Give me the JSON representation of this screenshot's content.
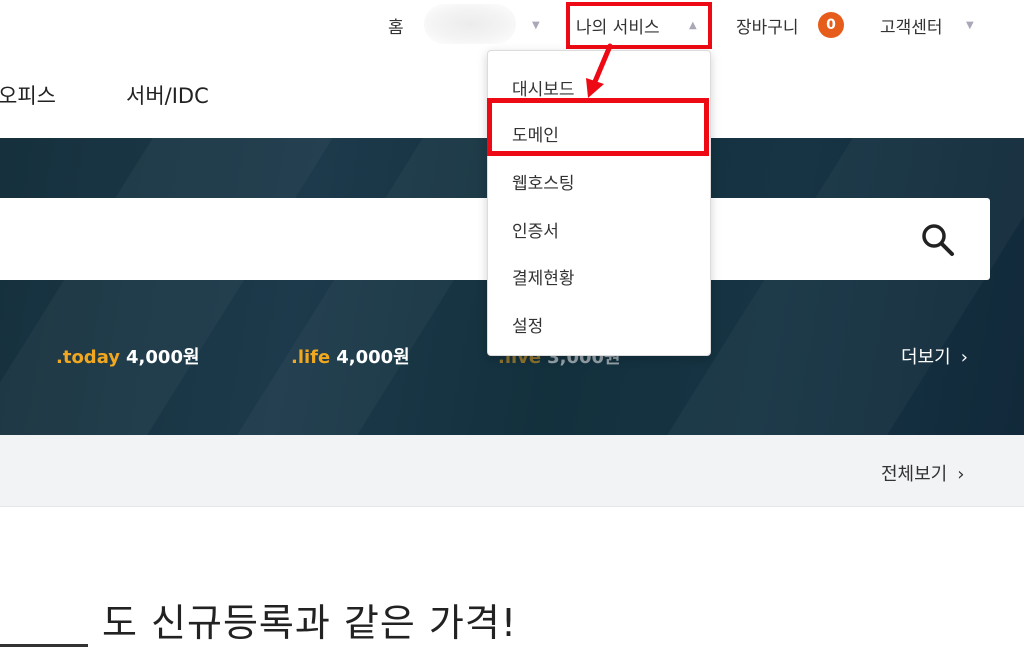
{
  "topbar": {
    "home_label": "홈",
    "my_service_label": "나의 서비스",
    "cart_label": "장바구니",
    "cart_count": "0",
    "customer_center_label": "고객센터"
  },
  "main_nav": {
    "items": [
      {
        "label": "오피스"
      },
      {
        "label": "서버/IDC"
      }
    ]
  },
  "hero": {
    "prices": [
      {
        "tld": ".today",
        "price": "4,000원"
      },
      {
        "tld": ".life",
        "price": "4,000원"
      },
      {
        "tld": ".live",
        "price": "3,000원"
      }
    ],
    "more_label": "더보기"
  },
  "strip": {
    "view_all_label": "전체보기"
  },
  "headline": {
    "text": "도 신규등록과 같은 가격!"
  },
  "dropdown": {
    "items": [
      {
        "label": "대시보드"
      },
      {
        "label": "도메인"
      },
      {
        "label": "웹호스팅"
      },
      {
        "label": "인증서"
      },
      {
        "label": "결제현황"
      },
      {
        "label": "설정"
      }
    ]
  },
  "colors": {
    "highlight": "#ee0a14",
    "tld_accent": "#f2a81e",
    "badge": "#e65c1a",
    "hero_bg": "#16303d"
  },
  "icons": {
    "search": "search-icon",
    "chevron": "chevron-right-icon",
    "caret": "caret-icon"
  }
}
